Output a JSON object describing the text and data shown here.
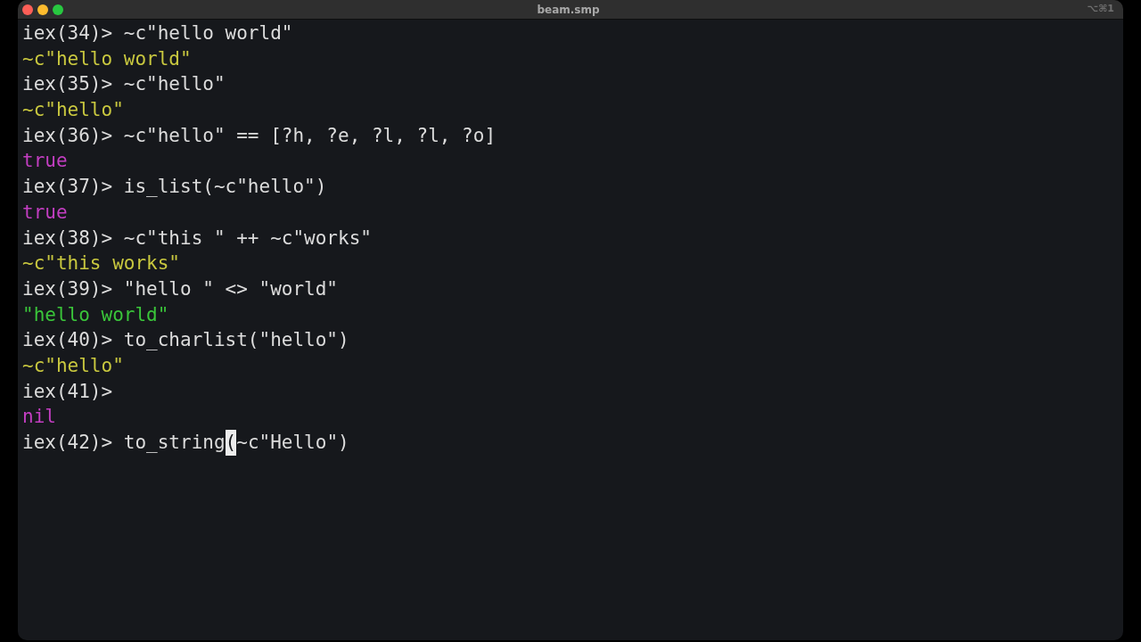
{
  "window": {
    "title": "beam.smp",
    "shortcut": "⌥⌘1"
  },
  "terminal": {
    "lines": [
      {
        "kind": "input",
        "prompt": "iex(34)>",
        "segments": [
          {
            "text": "~c\"hello world\"",
            "cursor": false
          }
        ]
      },
      {
        "kind": "output",
        "text": "~c\"hello world\"",
        "color": "#c9c83f"
      },
      {
        "kind": "input",
        "prompt": "iex(35)>",
        "segments": [
          {
            "text": "~c\"hello\"",
            "cursor": false
          }
        ]
      },
      {
        "kind": "output",
        "text": "~c\"hello\"",
        "color": "#c9c83f"
      },
      {
        "kind": "input",
        "prompt": "iex(36)>",
        "segments": [
          {
            "text": "~c\"hello\" == [?h, ?e, ?l, ?l, ?o]",
            "cursor": false
          }
        ]
      },
      {
        "kind": "output",
        "text": "true",
        "color": "#c23ec1"
      },
      {
        "kind": "input",
        "prompt": "iex(37)>",
        "segments": [
          {
            "text": "is_list(~c\"hello\")",
            "cursor": false
          }
        ]
      },
      {
        "kind": "output",
        "text": "true",
        "color": "#c23ec1"
      },
      {
        "kind": "input",
        "prompt": "iex(38)>",
        "segments": [
          {
            "text": "~c\"this \" ++ ~c\"works\"",
            "cursor": false
          }
        ]
      },
      {
        "kind": "output",
        "text": "~c\"this works\"",
        "color": "#c9c83f"
      },
      {
        "kind": "input",
        "prompt": "iex(39)>",
        "segments": [
          {
            "text": "\"hello \" <> \"world\"",
            "cursor": false
          }
        ]
      },
      {
        "kind": "output",
        "text": "\"hello world\"",
        "color": "#3ac53a"
      },
      {
        "kind": "input",
        "prompt": "iex(40)>",
        "segments": [
          {
            "text": "to_charlist(\"hello\")",
            "cursor": false
          }
        ]
      },
      {
        "kind": "output",
        "text": "~c\"hello\"",
        "color": "#c9c83f"
      },
      {
        "kind": "input",
        "prompt": "iex(41)>"
      },
      {
        "kind": "output",
        "text": "nil",
        "color": "#c23ec1"
      },
      {
        "kind": "input",
        "prompt": "iex(42)>",
        "segments": [
          {
            "text": "to_string",
            "cursor": false
          },
          {
            "text": "(",
            "cursor": true
          },
          {
            "text": "~c\"Hello\")",
            "cursor": false
          }
        ]
      }
    ]
  }
}
